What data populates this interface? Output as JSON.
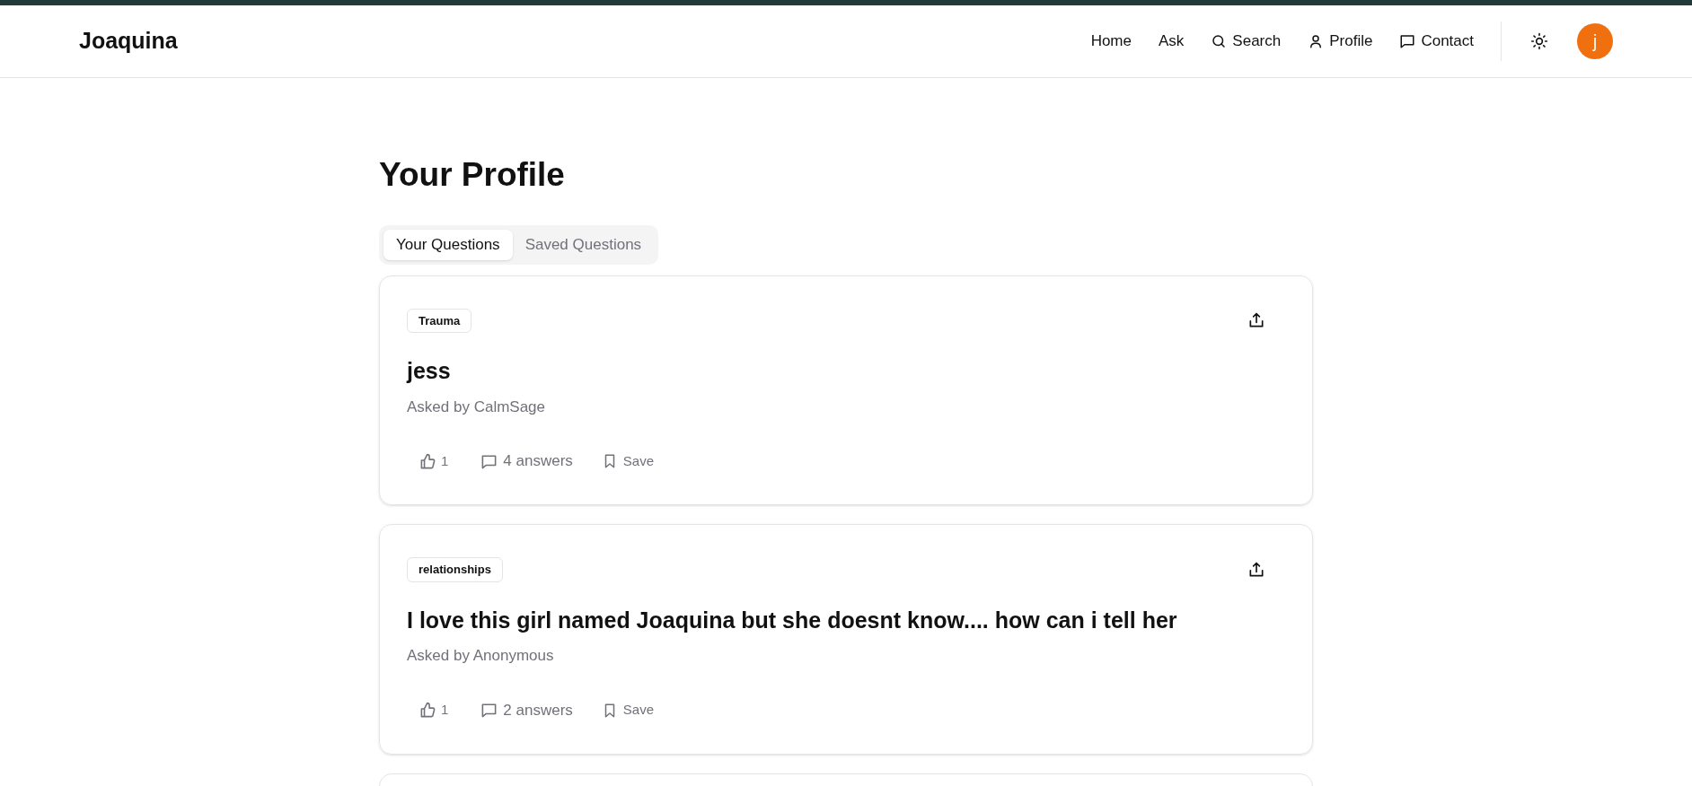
{
  "header": {
    "brand": "Joaquina",
    "nav": [
      {
        "label": "Home",
        "kind": "plain"
      },
      {
        "label": "Ask",
        "kind": "plain"
      },
      {
        "label": "Search",
        "kind": "search"
      },
      {
        "label": "Profile",
        "kind": "profile"
      },
      {
        "label": "Contact",
        "kind": "contact"
      }
    ],
    "avatar": "j"
  },
  "page": {
    "title": "Your Profile",
    "tabs": [
      {
        "label": "Your Questions",
        "selected": true
      },
      {
        "label": "Saved Questions",
        "selected": false
      }
    ],
    "questions": [
      {
        "tag": "Trauma",
        "title": "jess",
        "asked_by": "Asked by CalmSage",
        "likes": "1",
        "answers": "4 answers",
        "save": "Save"
      },
      {
        "tag": "relationships",
        "title": "I love this girl named Joaquina but she doesnt know.... how can i tell her",
        "asked_by": "Asked by Anonymous",
        "likes": "1",
        "answers": "2 answers",
        "save": "Save"
      }
    ]
  }
}
